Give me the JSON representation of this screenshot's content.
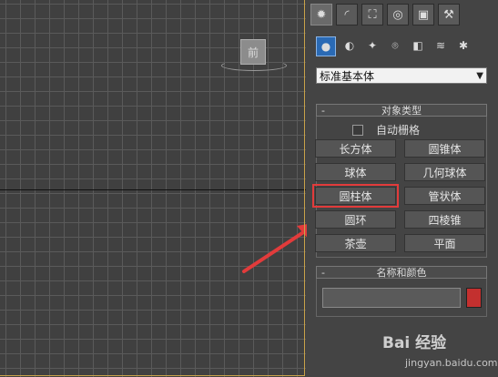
{
  "viewport": {
    "viewcube_label": "前"
  },
  "panel": {
    "tabs": [
      {
        "icon": "create-icon",
        "glyph": "✹"
      },
      {
        "icon": "modify-icon",
        "glyph": "◜"
      },
      {
        "icon": "hierarchy-icon",
        "glyph": "⛶"
      },
      {
        "icon": "motion-icon",
        "glyph": "◎"
      },
      {
        "icon": "display-icon",
        "glyph": "▣"
      },
      {
        "icon": "utilities-icon",
        "glyph": "⚒"
      }
    ],
    "subcategories": [
      {
        "icon": "geometry-icon",
        "glyph": "●"
      },
      {
        "icon": "shapes-icon",
        "glyph": "◐"
      },
      {
        "icon": "lights-icon",
        "glyph": "✦"
      },
      {
        "icon": "cameras-icon",
        "glyph": "⌾"
      },
      {
        "icon": "helpers-icon",
        "glyph": "◧"
      },
      {
        "icon": "spacewarps-icon",
        "glyph": "≋"
      },
      {
        "icon": "systems-icon",
        "glyph": "✱"
      }
    ],
    "dropdown": {
      "selected": "标准基本体",
      "arrow": "▼"
    },
    "object_type": {
      "title": "对象类型",
      "collapse": "-",
      "autogrid_label": "自动栅格",
      "buttons": [
        "长方体",
        "圆锥体",
        "球体",
        "几何球体",
        "圆柱体",
        "管状体",
        "圆环",
        "四棱锥",
        "茶壶",
        "平面"
      ]
    },
    "name_color": {
      "title": "名称和颜色",
      "collapse": "-",
      "name_value": "",
      "color": "#c3302f"
    }
  },
  "watermark": {
    "text": "Bai 经验",
    "sub": "jingyan.baidu.com"
  }
}
